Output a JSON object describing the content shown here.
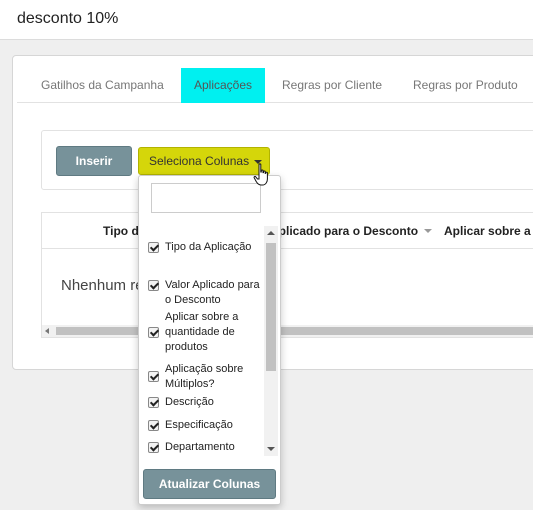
{
  "page": {
    "title": "desconto 10%"
  },
  "tabs": [
    {
      "label": "Gatilhos da Campanha",
      "active": false
    },
    {
      "label": "Aplicações",
      "active": true
    },
    {
      "label": "Regras por Cliente",
      "active": false
    },
    {
      "label": "Regras por Produto",
      "active": false
    }
  ],
  "toolbar": {
    "insert_label": "Inserir",
    "columns_label": "Seleciona Colunas"
  },
  "table": {
    "headers": [
      "Tipo d",
      "Aplicado para o Desconto",
      "Aplicar sobre a q"
    ],
    "empty_message": "Nhenhum re"
  },
  "column_selector": {
    "search_value": "",
    "options": [
      {
        "label": "Tipo da Aplicação",
        "checked": true
      },
      {
        "label": "Valor Aplicado para o Desconto",
        "checked": true
      },
      {
        "label": "Aplicar sobre a quantidade de produtos",
        "checked": true
      },
      {
        "label": "Aplicação sobre Múltiplos?",
        "checked": true
      },
      {
        "label": "Descrição",
        "checked": true
      },
      {
        "label": "Especificação",
        "checked": true
      },
      {
        "label": "Departamento",
        "checked": true
      }
    ],
    "update_label": "Atualizar Colunas"
  },
  "colors": {
    "active_tab": "#00f0f0",
    "columns_button": "#d5d60a",
    "primary_button": "#77929a"
  }
}
